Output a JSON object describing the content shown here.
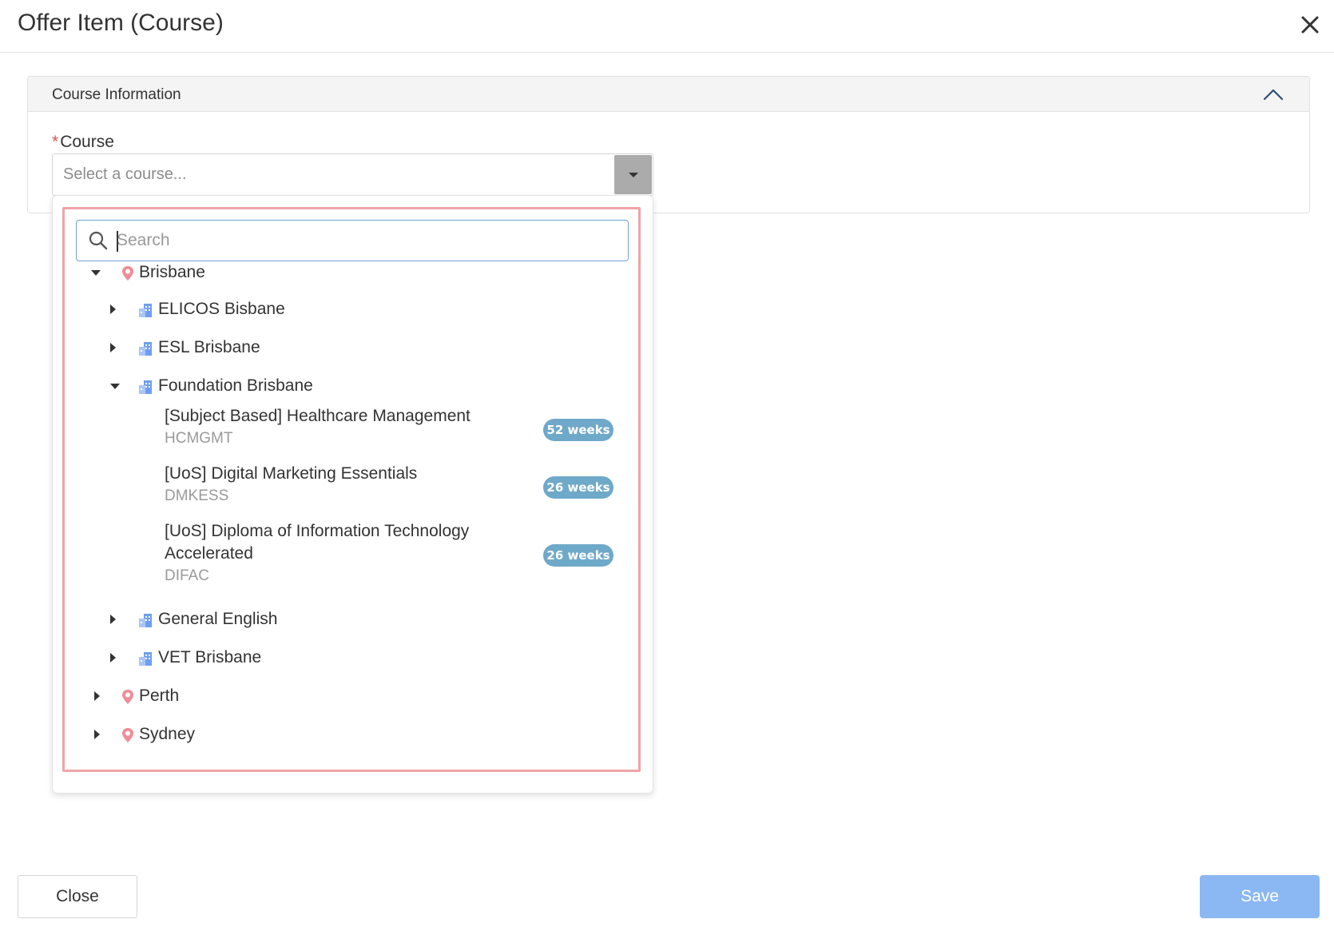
{
  "modal": {
    "title": "Offer Item (Course)"
  },
  "section": {
    "title": "Course Information",
    "field_label": "Course",
    "required_marker": "*",
    "select_placeholder": "Select a course..."
  },
  "dropdown": {
    "search_placeholder": "Search",
    "tree": {
      "locations": [
        {
          "name": "Brisbane",
          "expanded": true,
          "providers": [
            {
              "name": "ELICOS Bisbane",
              "expanded": false
            },
            {
              "name": "ESL Brisbane",
              "expanded": false
            },
            {
              "name": "Foundation Brisbane",
              "expanded": true,
              "courses": [
                {
                  "name": "[Subject Based] Healthcare Management",
                  "code": "HCMGMT",
                  "duration": "52 weeks"
                },
                {
                  "name": "[UoS] Digital Marketing Essentials",
                  "code": "DMKESS",
                  "duration": "26 weeks"
                },
                {
                  "name_line1": "[UoS] Diploma of Information Technology",
                  "name_line2": "Accelerated",
                  "code": "DIFAC",
                  "duration": "26 weeks"
                }
              ]
            },
            {
              "name": "General English",
              "expanded": false
            },
            {
              "name": "VET Brisbane",
              "expanded": false
            }
          ]
        },
        {
          "name": "Perth",
          "expanded": false
        },
        {
          "name": "Sydney",
          "expanded": false
        }
      ]
    }
  },
  "footer": {
    "close_label": "Close",
    "save_label": "Save"
  },
  "colors": {
    "location_pin": "#ef8d96",
    "provider_icon": "#6f9ef0",
    "badge": "#6fa9c9",
    "highlight_border": "#f0a4a8",
    "save_button": "#8bb8f2",
    "required": "#d9534f"
  },
  "icons": {
    "close": "close-icon",
    "collapse": "chevron-up-icon",
    "dropdown": "caret-down-icon",
    "search": "search-icon",
    "location": "location-pin-icon",
    "provider": "building-icon"
  }
}
